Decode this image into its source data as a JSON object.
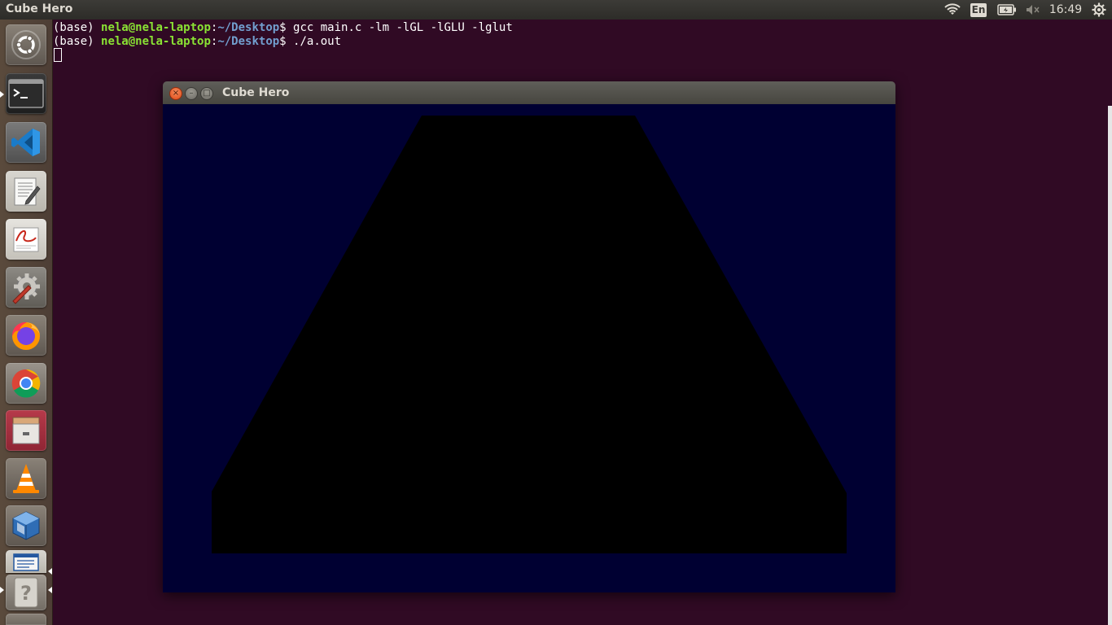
{
  "top_panel": {
    "active_app_title": "Cube Hero",
    "keyboard_layout": "En",
    "clock": "16:49",
    "icons": [
      "wifi-icon",
      "battery-icon",
      "volume-muted-icon",
      "settings-gear-icon"
    ]
  },
  "launcher": {
    "items": [
      {
        "name": "dash-home",
        "icon": "ubuntu-logo-icon"
      },
      {
        "name": "terminal",
        "icon": "terminal-icon"
      },
      {
        "name": "visual-studio-code",
        "icon": "vscode-icon"
      },
      {
        "name": "text-editor",
        "icon": "text-editor-icon"
      },
      {
        "name": "document-viewer",
        "icon": "document-viewer-icon"
      },
      {
        "name": "system-settings",
        "icon": "settings-wrench-icon"
      },
      {
        "name": "firefox",
        "icon": "firefox-icon"
      },
      {
        "name": "chrome",
        "icon": "chrome-icon"
      },
      {
        "name": "file-manager",
        "icon": "file-cabinet-icon"
      },
      {
        "name": "vlc",
        "icon": "vlc-cone-icon"
      },
      {
        "name": "virtualbox",
        "icon": "virtualbox-cube-icon"
      },
      {
        "name": "cube-hero-app",
        "icon": "glut-window-icon"
      },
      {
        "name": "unknown-app",
        "icon": "question-mark-icon"
      }
    ]
  },
  "terminal": {
    "lines": [
      {
        "prefix": "(base) ",
        "user": "nela@nela-laptop",
        "sep": ":",
        "path": "~/Desktop",
        "suffix": "$ ",
        "command": "gcc main.c -lm -lGL -lGLU -lglut"
      },
      {
        "prefix": "(base) ",
        "user": "nela@nela-laptop",
        "sep": ":",
        "path": "~/Desktop",
        "suffix": "$ ",
        "command": "./a.out"
      }
    ],
    "colors": {
      "background": "#300a24",
      "user": "#8ae234",
      "path": "#729fcf",
      "text": "#ffffff"
    }
  },
  "cube_window": {
    "title": "Cube Hero",
    "buttons": {
      "close": "×",
      "minimize": "–",
      "maximize": "□"
    },
    "colors": {
      "background": "#000032",
      "shape": "#000000"
    }
  }
}
